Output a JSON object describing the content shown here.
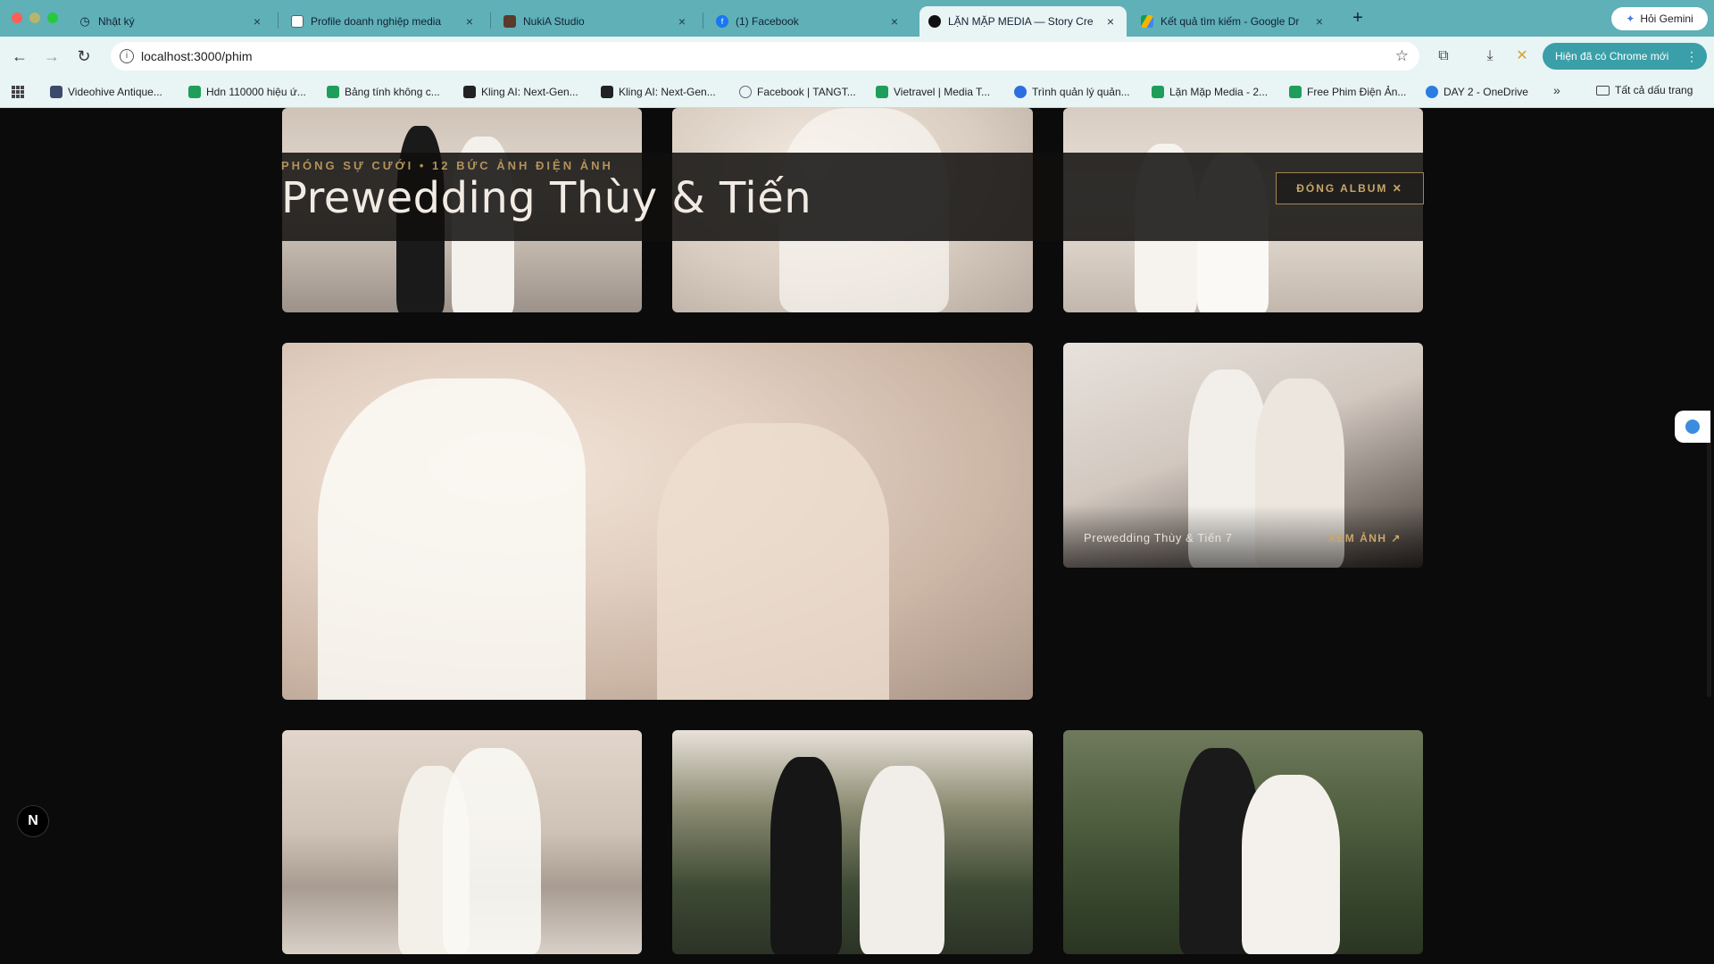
{
  "browser": {
    "tabs": [
      {
        "title": "Nhật ký",
        "active": false
      },
      {
        "title": "Profile doanh nghiệp media",
        "active": false
      },
      {
        "title": "NukiA Studio",
        "active": false
      },
      {
        "title": "(1) Facebook",
        "active": false
      },
      {
        "title": "LẶN MẶP MEDIA — Story Cre",
        "active": true
      },
      {
        "title": "Kết quả tìm kiếm - Google Dr",
        "active": false
      }
    ],
    "new_tab": "+",
    "gemini_label": "Hỏi Gemini",
    "url": "localhost:3000/phim",
    "update_label": "Hiện đã có Chrome mới",
    "bookmarks": [
      "Videohive Antique...",
      "Hdn 110000 hiệu ứ...",
      "Bảng tính không c...",
      "Kling AI: Next-Gen...",
      "Kling AI: Next-Gen...",
      "Facebook | TANGT...",
      "Vietravel | Media T...",
      "Trình quản lý quản...",
      "Lặn Mặp Media - 2...",
      "Free Phim Điện Ản...",
      "DAY 2 - OneDrive"
    ],
    "bookmarks_more": "»",
    "all_bookmarks": "Tất cả dấu trang"
  },
  "album": {
    "eyebrow": "PHÓNG SỰ CƯỚI  •  12 BỨC ẢNH ĐIỆN ẢNH",
    "title": "Prewedding Thùy & Tiến",
    "close_label": "ĐÓNG ALBUM ✕"
  },
  "featured": {
    "caption": "Prewedding Thùy & Tiến 7",
    "link_label": "XEM ẢNH ↗"
  },
  "badge": "N",
  "colors": {
    "accent_gold": "#b3915a",
    "background": "#0b0b0c",
    "tabbar": "#5fb0b7"
  }
}
